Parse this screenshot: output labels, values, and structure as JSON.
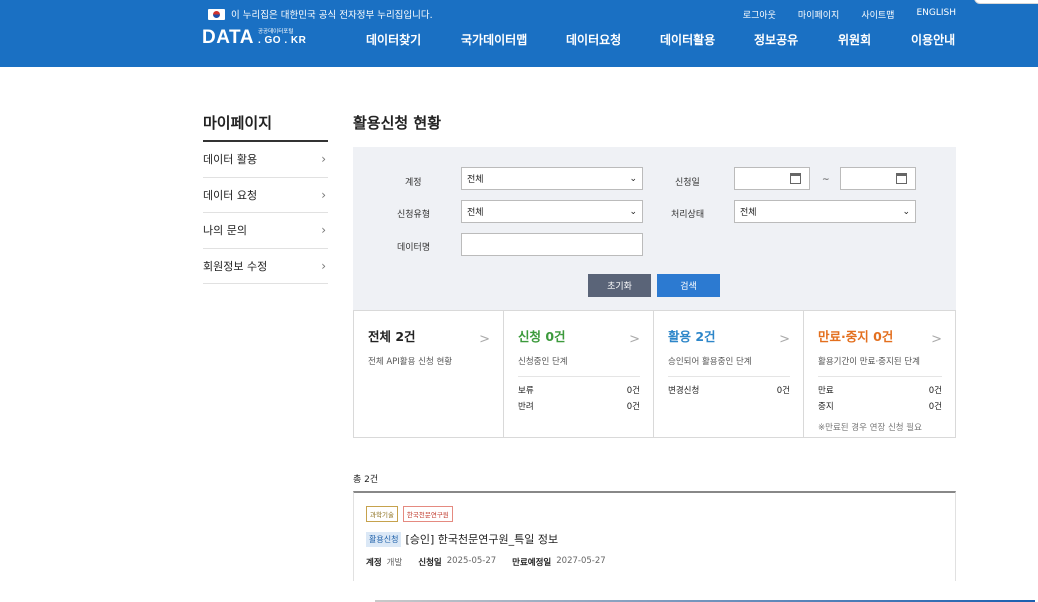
{
  "header": {
    "gov_notice": "이 누리집은 대한민국 공식 전자정부 누리집입니다.",
    "util_links": [
      "로그아웃",
      "마이페이지",
      "사이트맵",
      "ENGLISH"
    ],
    "logo_main": "DATA",
    "logo_small": "공공데이터포털",
    "logo_domain": ". GO . KR",
    "nav": [
      "데이터찾기",
      "국가데이터맵",
      "데이터요청",
      "데이터활용",
      "정보공유",
      "위원회",
      "이용안내"
    ]
  },
  "sidebar": {
    "title": "마이페이지",
    "items": [
      {
        "label": "데이터 활용"
      },
      {
        "label": "데이터 요청"
      },
      {
        "label": "나의 문의"
      },
      {
        "label": "회원정보 수정"
      }
    ]
  },
  "main": {
    "title": "활용신청 현황",
    "search": {
      "account_label": "계정",
      "account_value": "전체",
      "date_label": "신청일",
      "date_sep": "~",
      "type_label": "신청유형",
      "type_value": "전체",
      "status_label": "처리상태",
      "status_value": "전체",
      "dataname_label": "데이터명",
      "dataname_value": "",
      "reset_label": "초기화",
      "search_label": "검색"
    },
    "stats": [
      {
        "head": "전체 2건",
        "desc": "전체 API활용 신청 현황",
        "rows": [],
        "note": ""
      },
      {
        "head": "신청 0건",
        "desc": "신청중인 단계",
        "rows": [
          {
            "k": "보류",
            "v": "0건"
          },
          {
            "k": "반려",
            "v": "0건"
          }
        ],
        "note": ""
      },
      {
        "head": "활용 2건",
        "desc": "승인되어 활용중인 단계",
        "rows": [
          {
            "k": "변경신청",
            "v": "0건"
          }
        ],
        "note": ""
      },
      {
        "head": "만료·중지 0건",
        "desc": "활용기간이 만료·중지된 단계",
        "rows": [
          {
            "k": "만료",
            "v": "0건"
          },
          {
            "k": "중지",
            "v": "0건"
          }
        ],
        "note": "※만료된 경우 연장 신청 필요"
      }
    ],
    "stat_arrow": ">",
    "total": "총 2건",
    "list": [
      {
        "tag_category": "과학기술",
        "tag_org": "한국천문연구원",
        "badge": "활용신청",
        "title": "[승인] 한국천문연구원_특일 정보",
        "account_label": "계정",
        "account_value": "개발",
        "apply_label": "신청일",
        "apply_value": "2025-05-27",
        "expire_label": "만료예정일",
        "expire_value": "2027-05-27"
      }
    ]
  },
  "colors": {
    "header_bg": "#1a70c3",
    "stat_all": "#222222",
    "stat_apply": "#3c9a3c",
    "stat_use": "#2d86c9",
    "stat_expire": "#e36f1e",
    "reset_btn": "#5a6478",
    "search_btn": "#2c7ad1"
  },
  "icons": [
    "flag-icon",
    "chevron-right-icon",
    "calendar-icon",
    "caret-down-icon"
  ]
}
